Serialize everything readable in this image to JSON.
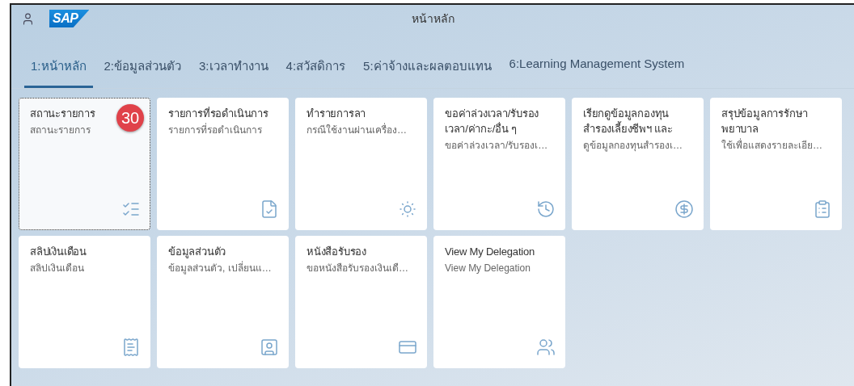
{
  "header": {
    "logo": "SAP",
    "title": "หน้าหลัก"
  },
  "tabs": [
    {
      "label": "1:หน้าหลัก",
      "selected": true
    },
    {
      "label": "2:ข้อมูลส่วนตัว",
      "selected": false
    },
    {
      "label": "3:เวลาทำงาน",
      "selected": false
    },
    {
      "label": "4:สวัสดิการ",
      "selected": false
    },
    {
      "label": "5:ค่าจ้างและผลตอบแทน",
      "selected": false
    },
    {
      "label": "6:Learning Management System",
      "selected": false
    }
  ],
  "tiles": [
    {
      "title": "สถานะรายการ",
      "subtitle": "สถานะรายการ",
      "badge": "30",
      "focused": true
    },
    {
      "title": "รายการที่รอดำเนินการ",
      "subtitle": "รายการที่รอดำเนินการ",
      "focused": false
    },
    {
      "title": "ทำรายการลา",
      "subtitle": "กรณีใช้งานผ่านเครื่อง…",
      "focused": false
    },
    {
      "title": "ขอค่าล่วงเวลา/รับรองเวลา/ค่ากะ/อื่น ๆ",
      "subtitle": "ขอค่าล่วงเวลา/รับรองเ…",
      "focused": false
    },
    {
      "title": "เรียกดูข้อมูลกองทุนสำรองเลี้ยงชีพฯ และ",
      "subtitle": "ดูข้อมูลกองทุนสำรองเ…",
      "focused": false
    },
    {
      "title": "สรุปข้อมูลการรักษาพยาบาล",
      "subtitle": "ใช้เพื่อแสดงรายละเอีย…",
      "focused": false
    },
    {
      "title": "สลิปเงินเดือน",
      "subtitle": "สลิปเงินเดือน",
      "focused": false
    },
    {
      "title": "ข้อมูลส่วนตัว",
      "subtitle": "ข้อมูลส่วนตัว, เปลี่ยนแ…",
      "focused": false
    },
    {
      "title": "หนังสือรับรอง",
      "subtitle": "ขอหนังสือรับรองเงินเดื…",
      "focused": false
    },
    {
      "title": "View My Delegation",
      "subtitle": "View My Delegation",
      "focused": false
    }
  ]
}
